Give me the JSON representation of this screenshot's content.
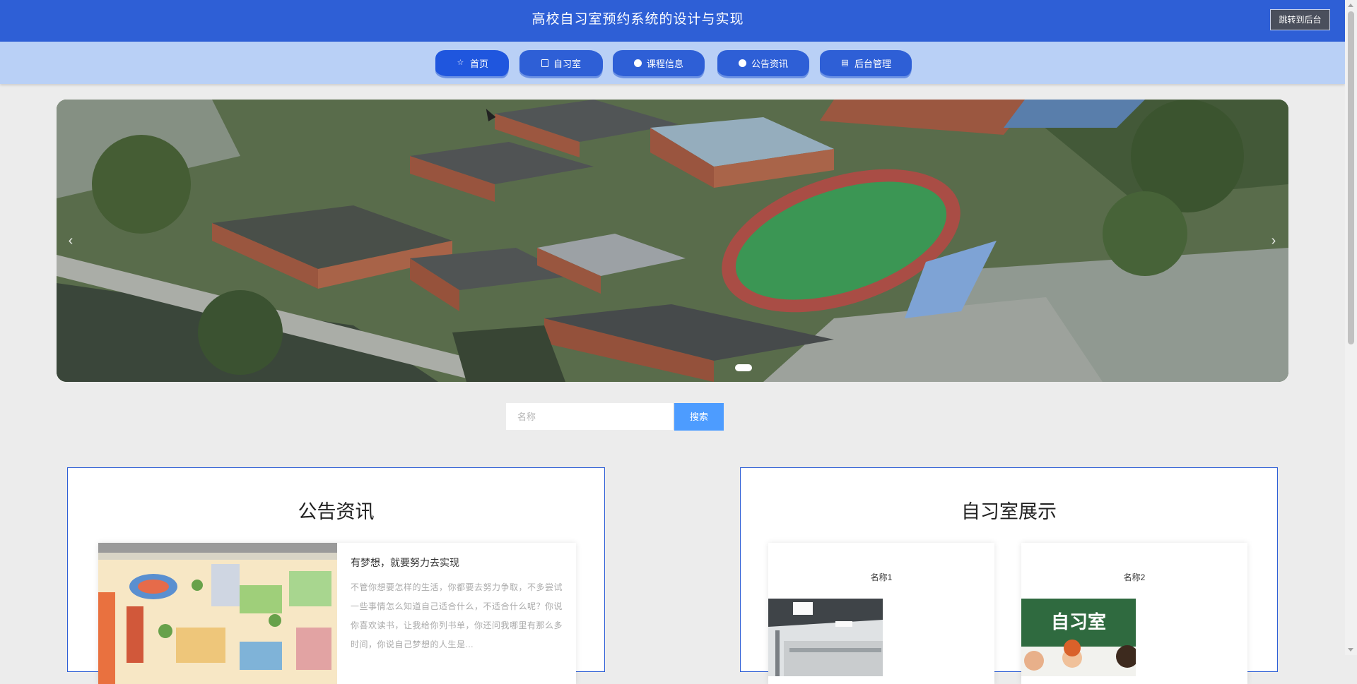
{
  "header": {
    "title": "高校自习室预约系统的设计与实现",
    "button_label": "跳转到后台"
  },
  "nav": {
    "items": [
      {
        "label": "首页",
        "icon": "star-icon"
      },
      {
        "label": "自习室",
        "icon": "room-icon"
      },
      {
        "label": "课程信息",
        "icon": "dot-icon"
      },
      {
        "label": "公告资讯",
        "icon": "dot-icon"
      },
      {
        "label": "后台管理",
        "icon": "admin-icon"
      }
    ],
    "active": "首页"
  },
  "banner": {
    "prev": "‹",
    "next": "›",
    "slide_count": 1,
    "active_slide": 1
  },
  "search": {
    "placeholder": "名称",
    "button_label": "搜索"
  },
  "news": {
    "title": "公告资讯",
    "item": {
      "title": "有梦想，就要努力去实现",
      "summary": "不管你想要怎样的生活，你都要去努力争取，不多尝试一些事情怎么知道自己适合什么，不适合什么呢？你说你喜欢读书，让我给你列书单，你还问我哪里有那么多时间，你说自己梦想的人生是..."
    }
  },
  "rooms": {
    "title": "自习室展示",
    "items": [
      {
        "name": "名称1"
      },
      {
        "name": "名称2",
        "image_text": "自习室"
      }
    ]
  },
  "colors": {
    "header": "#2e5fd6",
    "nav": "#b9d0f6",
    "accent": "#4d9cff"
  }
}
